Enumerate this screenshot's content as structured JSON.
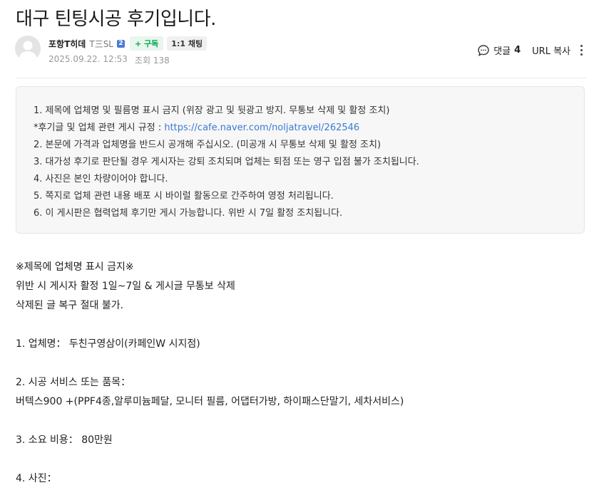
{
  "post": {
    "title": "대구 틴팅시공 후기입니다.",
    "author": {
      "name": "포항T히데",
      "grade": "T三SL",
      "grade_badge": "2",
      "subscribe_label": "+ 구독",
      "chat_label": "1:1 채팅"
    },
    "date": "2025.09.22. 12:53",
    "views": "조회 138",
    "comment_label": "댓글",
    "comment_count": "4",
    "url_copy_label": "URL 복사"
  },
  "notice": {
    "line1": "1. 제목에 업체명 및 필름명 표시 금지 (위장 광고 및 뒷광고 방지. 무통보 삭제 및 활정 조치)",
    "line2_prefix": "*후기글 및 업체 관련 게시 규정 : ",
    "line2_link": "https://cafe.naver.com/noljatravel/262546",
    "line3": "2. 본문에 가격과 업체명을 반드시 공개해 주십시오. (미공개 시 무통보 삭제 및 활정 조치)",
    "line4": "3. 대가성 후기로 판단될 경우 게시자는 강퇴 조치되며 업체는 퇴점 또는 영구 입점 불가 조치됩니다.",
    "line5": "4. 사진은 본인 차량이어야 합니다.",
    "line6": "5. 쪽지로 업체 관련 내용 배포 시 바이럴 활동으로 간주하여 영정 처리됩니다.",
    "line7": "6. 이 게시판은 협력업체 후기만 게시 가능합니다. 위반 시 7일 활정 조치됩니다."
  },
  "content": {
    "warn1": "※제목에 업체명 표시 금지※",
    "warn2": "위반 시 게시자 활정 1일~7일 & 게시글 무통보 삭제",
    "warn3": "삭제된 글 복구 절대 불가.",
    "company": "1. 업체명： 두친구영삼이(카페인W 시지점)",
    "service_label": "2. 시공 서비스 또는 품목：",
    "service_value": "버텍스900 +(PPF4종,알루미늄페달, 모니터 필름, 어댑터가방, 하이패스단말기, 세차서비스)",
    "cost": "3. 소요 비용： 80만원",
    "photo": "4. 사진："
  }
}
